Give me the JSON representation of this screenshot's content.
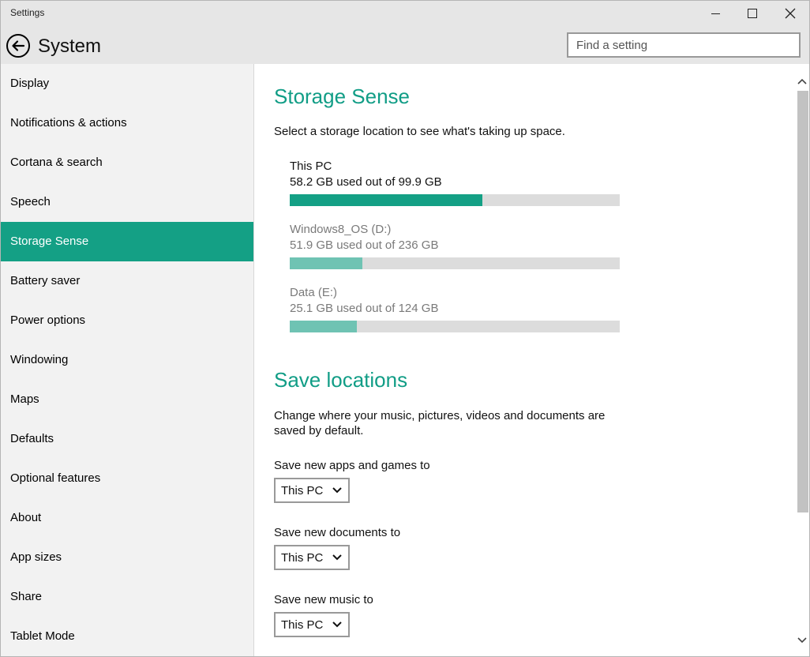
{
  "window": {
    "title": "Settings"
  },
  "header": {
    "back_icon": "back-arrow-icon",
    "title": "System"
  },
  "search": {
    "placeholder": "Find a setting"
  },
  "sidebar": {
    "items": [
      {
        "label": "Display"
      },
      {
        "label": "Notifications & actions"
      },
      {
        "label": "Cortana & search"
      },
      {
        "label": "Speech"
      },
      {
        "label": "Storage Sense",
        "selected": true
      },
      {
        "label": "Battery saver"
      },
      {
        "label": "Power options"
      },
      {
        "label": "Windowing"
      },
      {
        "label": "Maps"
      },
      {
        "label": "Defaults"
      },
      {
        "label": "Optional features"
      },
      {
        "label": "About"
      },
      {
        "label": "App sizes"
      },
      {
        "label": "Share"
      },
      {
        "label": "Tablet Mode"
      }
    ]
  },
  "storage": {
    "heading": "Storage Sense",
    "description": "Select a storage location to see what's taking up space.",
    "drives": [
      {
        "name": "This PC",
        "usage": "58.2 GB used out of 99.9 GB",
        "used_fraction": 0.5826,
        "state": "active"
      },
      {
        "name": "Windows8_OS (D:)",
        "usage": "51.9 GB used out of 236 GB",
        "used_fraction": 0.2199,
        "state": "inactive"
      },
      {
        "name": "Data (E:)",
        "usage": "25.1 GB used out of 124 GB",
        "used_fraction": 0.2024,
        "state": "inactive"
      }
    ]
  },
  "save_locations": {
    "heading": "Save locations",
    "description": "Change where your music, pictures, videos and documents are saved by default.",
    "fields": [
      {
        "label": "Save new apps and games to",
        "value": "This PC"
      },
      {
        "label": "Save new documents to",
        "value": "This PC"
      },
      {
        "label": "Save new music to",
        "value": "This PC"
      }
    ]
  },
  "colors": {
    "accent": "#14a085",
    "accent_light": "#6fc3b3",
    "heading": "#119d86",
    "sidebar_bg": "#f2f2f2",
    "header_bg": "#e6e6e6",
    "bar_track": "#dcdcdc"
  }
}
